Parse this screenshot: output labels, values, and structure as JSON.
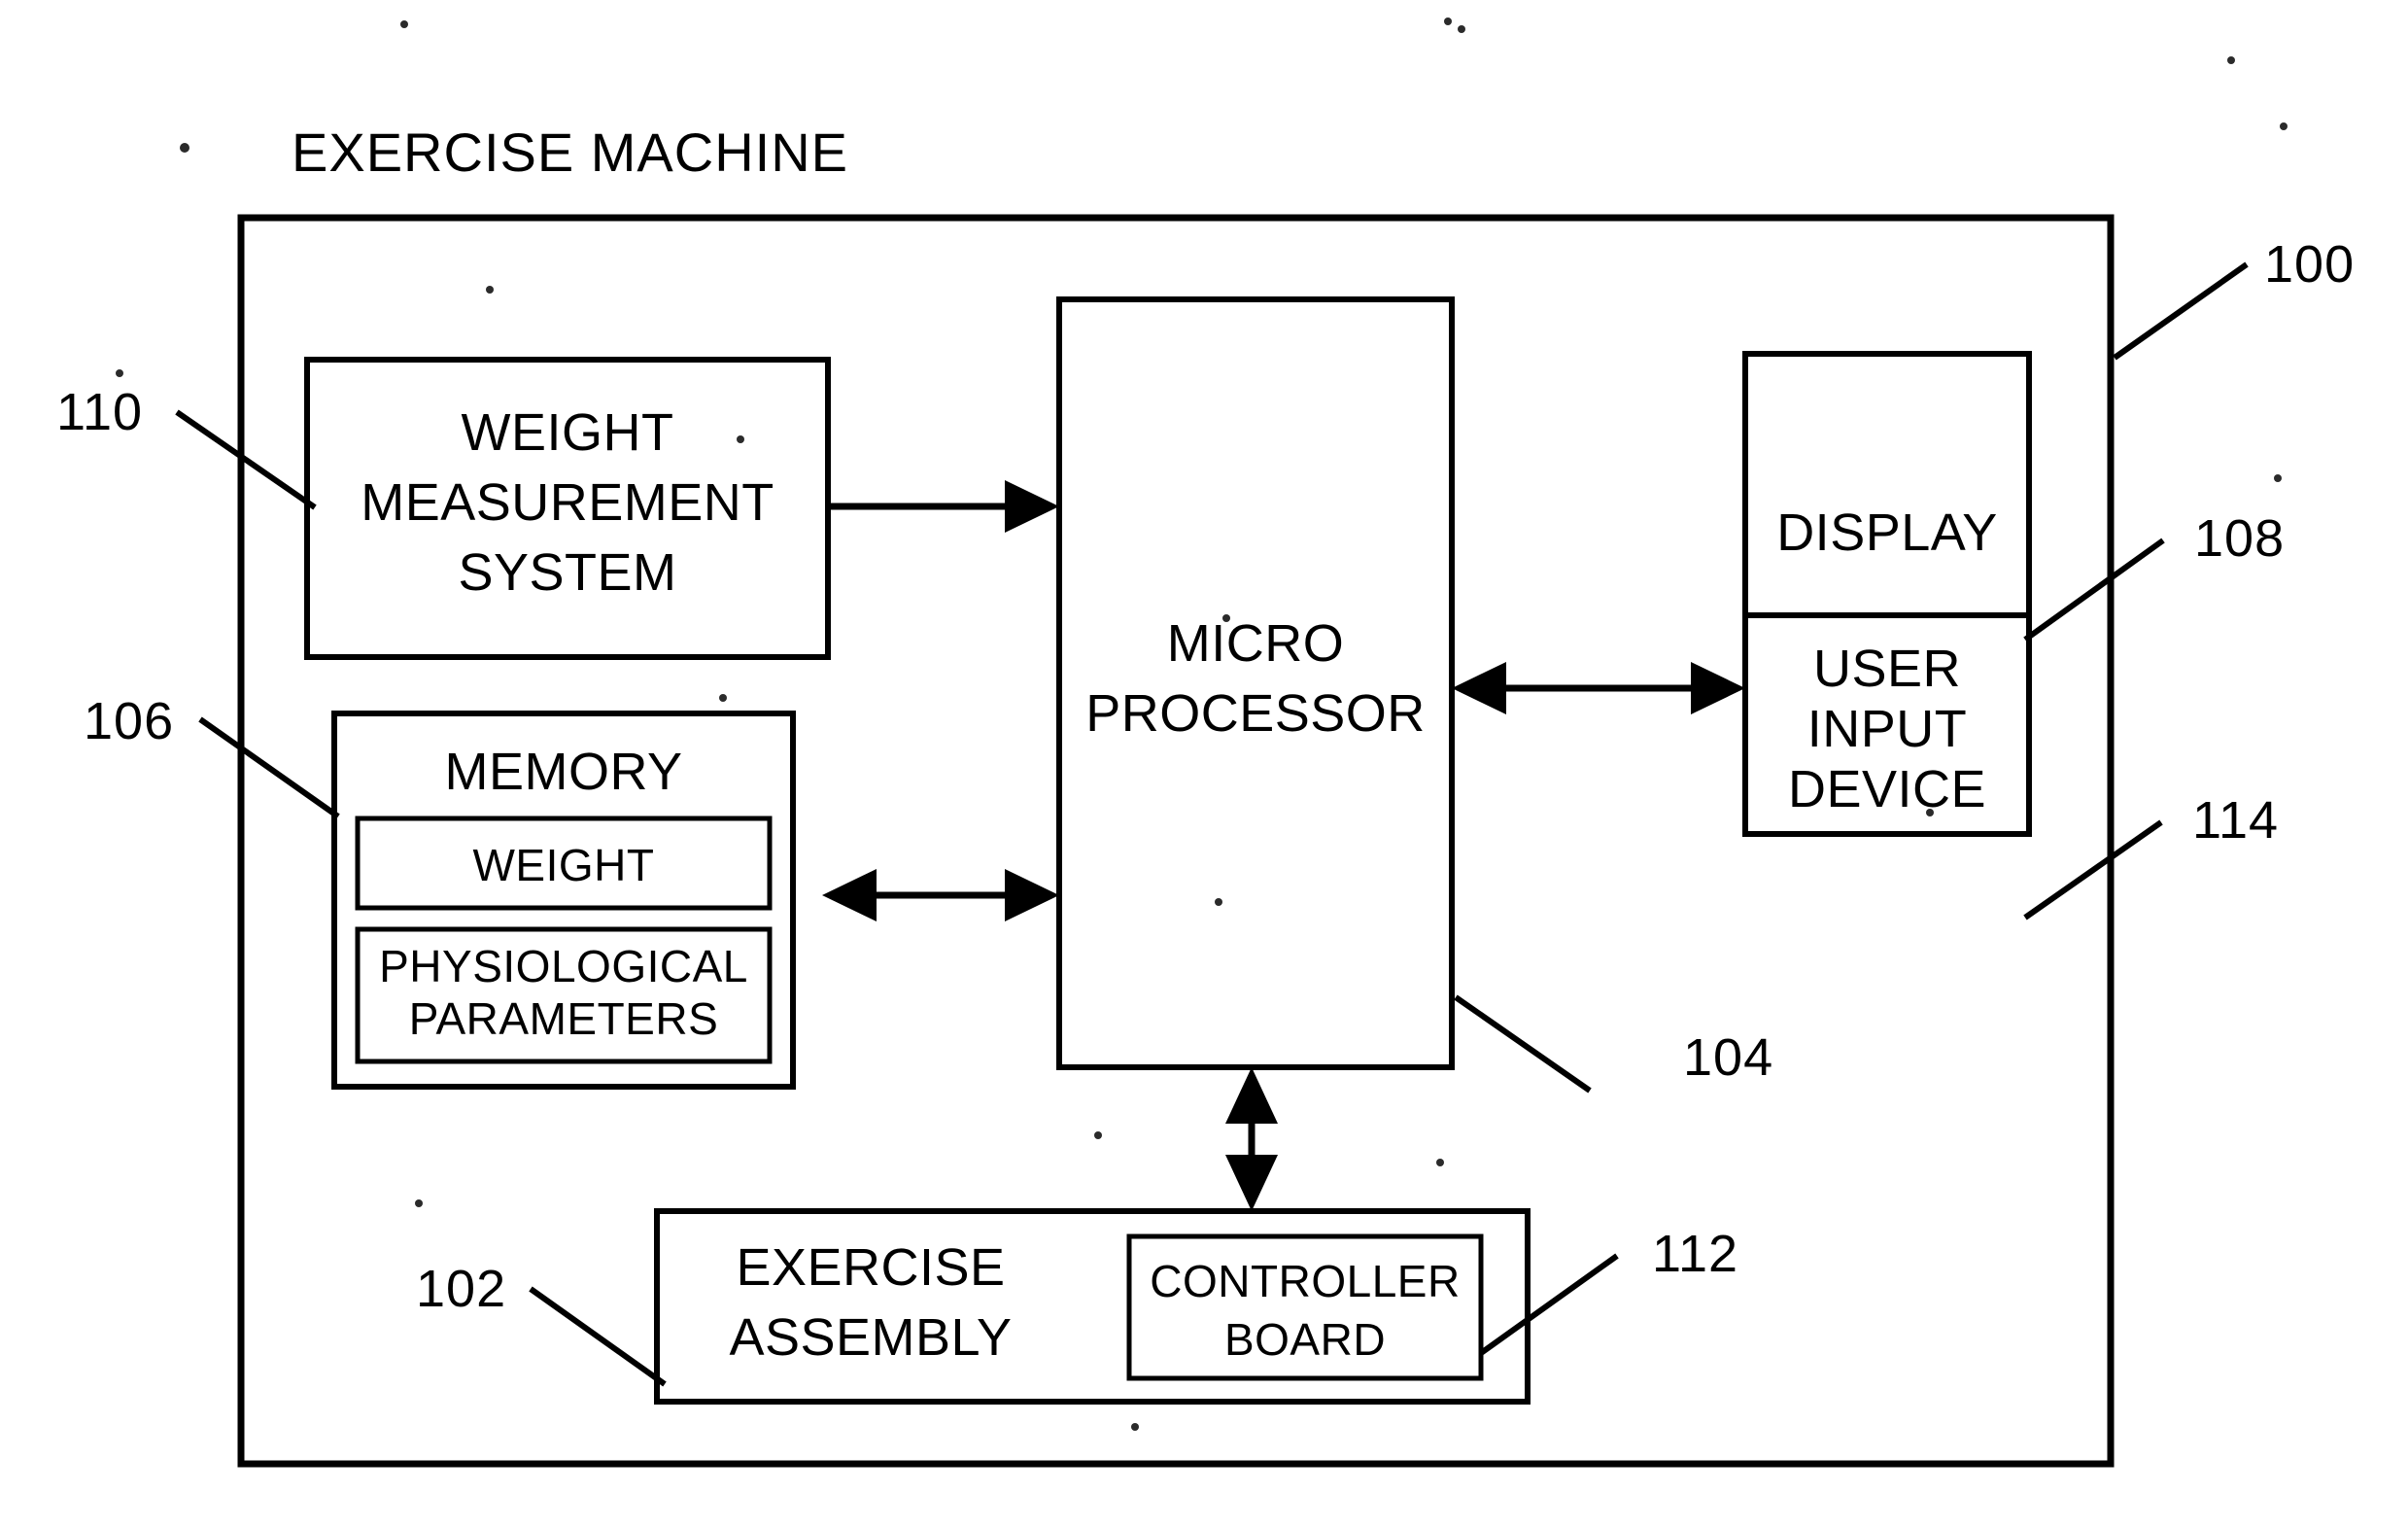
{
  "figure": {
    "title": "EXERCISE MACHINE",
    "outer_ref": "100"
  },
  "blocks": {
    "weight_measurement": {
      "line1": "WEIGHT",
      "line2": "MEASUREMENT",
      "line3": "SYSTEM",
      "ref": "110"
    },
    "memory": {
      "title": "MEMORY",
      "ref": "106",
      "sub_weight": "WEIGHT",
      "sub_physio_line1": "PHYSIOLOGICAL",
      "sub_physio_line2": "PARAMETERS"
    },
    "microprocessor": {
      "line1": "MICRO",
      "line2": "PROCESSOR",
      "ref": "104"
    },
    "display": {
      "label": "DISPLAY",
      "ref": "108"
    },
    "user_input": {
      "line1": "USER",
      "line2": "INPUT",
      "line3": "DEVICE",
      "ref": "114"
    },
    "exercise_assembly": {
      "line1": "EXERCISE",
      "line2": "ASSEMBLY",
      "ref": "102"
    },
    "controller_board": {
      "line1": "CONTROLLER",
      "line2": "BOARD",
      "ref": "112"
    }
  },
  "colors": {
    "ink": "#000000",
    "paper": "#ffffff"
  }
}
